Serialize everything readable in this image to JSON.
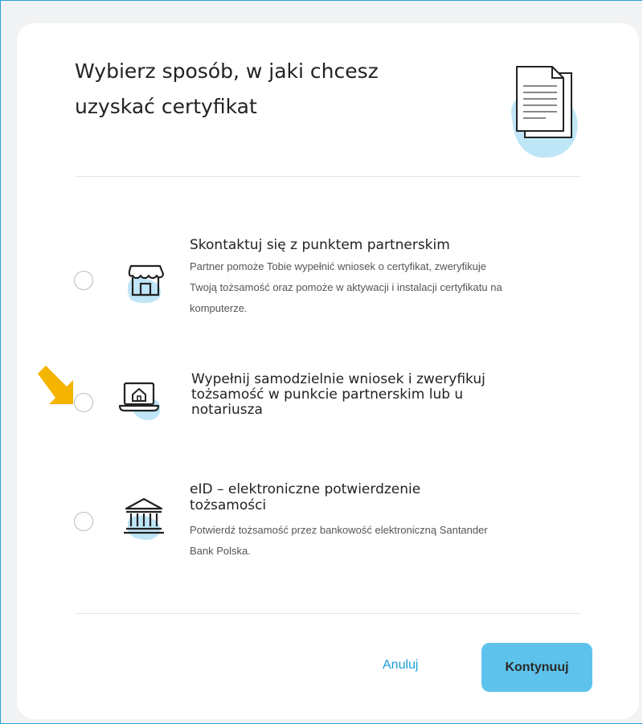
{
  "dialog": {
    "title": "Wybierz sposób, w jaki chcesz uzyskać certyfikat",
    "title_icon": "document-icon"
  },
  "options": [
    {
      "title": "Skontaktuj się z punktem partnerskim",
      "description": "Partner pomoże Tobie wypełnić wniosek o certyfikat, zweryfikuje Twoją tożsamość oraz pomoże w aktywacji i instalacji certyfikatu na komputerze.",
      "icon": "store-icon",
      "selected": false
    },
    {
      "title": "Wypełnij samodzielnie wniosek i zweryfikuj tożsamość w punkcie partnerskim lub u notariusza",
      "description": "",
      "icon": "laptop-home-icon",
      "selected": false
    },
    {
      "title": "eID – elektroniczne potwierdzenie tożsamości",
      "description": "Potwierdź tożsamość przez bankowość elektroniczną Santander Bank Polska.",
      "icon": "bank-icon",
      "selected": false
    }
  ],
  "footer": {
    "cancel_label": "Anuluj",
    "continue_label": "Kontynuuj"
  },
  "colors": {
    "accent": "#1a9fd9",
    "button_bg": "#5ec3ec",
    "icon_blob": "#bfe6f7",
    "pointer_arrow": "#f5b400"
  }
}
